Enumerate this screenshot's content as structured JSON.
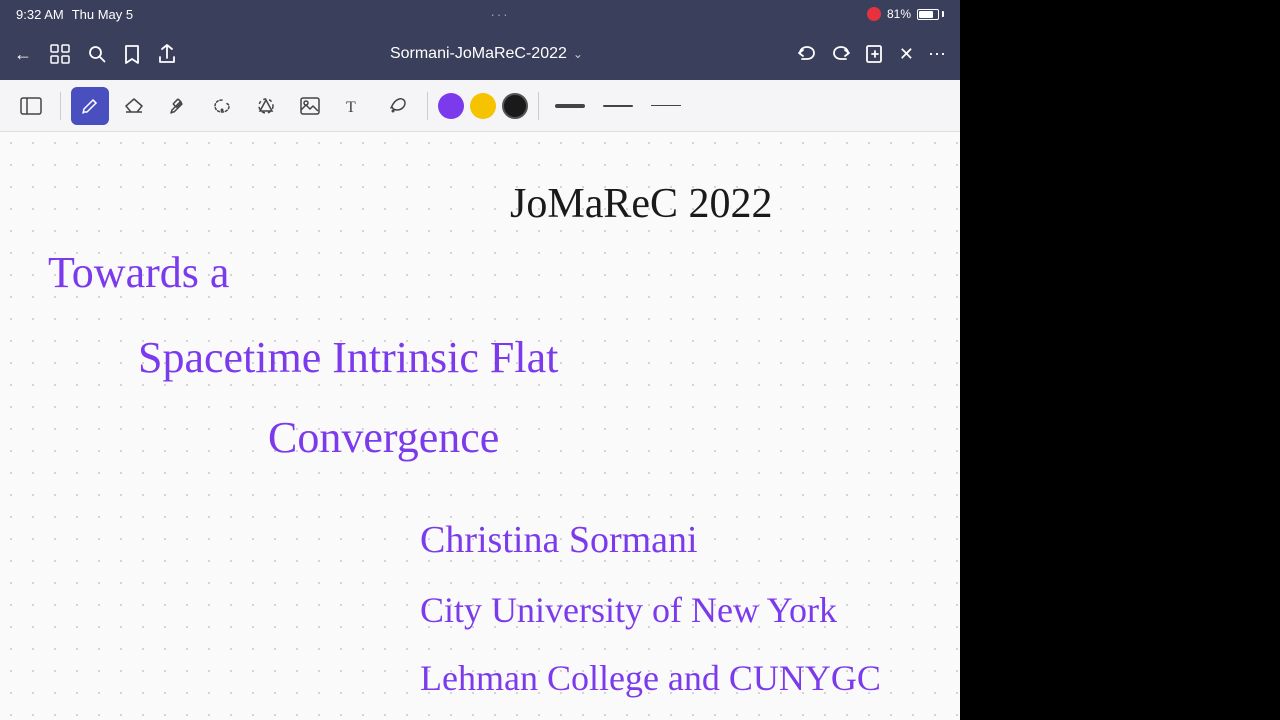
{
  "statusBar": {
    "time": "9:32 AM",
    "dayDate": "Thu May 5",
    "ellipsis": "···",
    "batteryPercent": "81%"
  },
  "navBar": {
    "title": "Sormani-JoMaReC-2022",
    "chevronLabel": "▾",
    "backIcon": "←",
    "gridIcon": "⊞",
    "searchIcon": "🔍",
    "bookmarkIcon": "🔖",
    "shareIcon": "⬆",
    "undoIcon": "↩",
    "redoIcon": "↪",
    "addPageIcon": "+□",
    "closeIcon": "✕",
    "moreIcon": "···"
  },
  "toolbar": {
    "collapseIcon": "◫",
    "penIcon": "✏",
    "eraserIcon": "◻",
    "highlighterIcon": "✏",
    "lassoIcon": "⊙",
    "shapeIcon": "△",
    "imageIcon": "🖼",
    "textIcon": "T",
    "inkIcon": "💧",
    "colors": [
      {
        "name": "purple",
        "hex": "#7c3aed"
      },
      {
        "name": "yellow",
        "hex": "#f5c300"
      },
      {
        "name": "black",
        "hex": "#1a1a1a"
      }
    ],
    "selectedColor": "black",
    "lineWeights": [
      "thick",
      "medium",
      "thin"
    ]
  },
  "noteContent": {
    "title": "JoMaReC  2022",
    "line1": "Towards a",
    "line2": "Spacetime Intrinsic Flat",
    "line3": "Convergence",
    "author": "Christina Sormani",
    "institution1": "City University of New York",
    "institution2": "Lehman College and CUNYGC"
  }
}
